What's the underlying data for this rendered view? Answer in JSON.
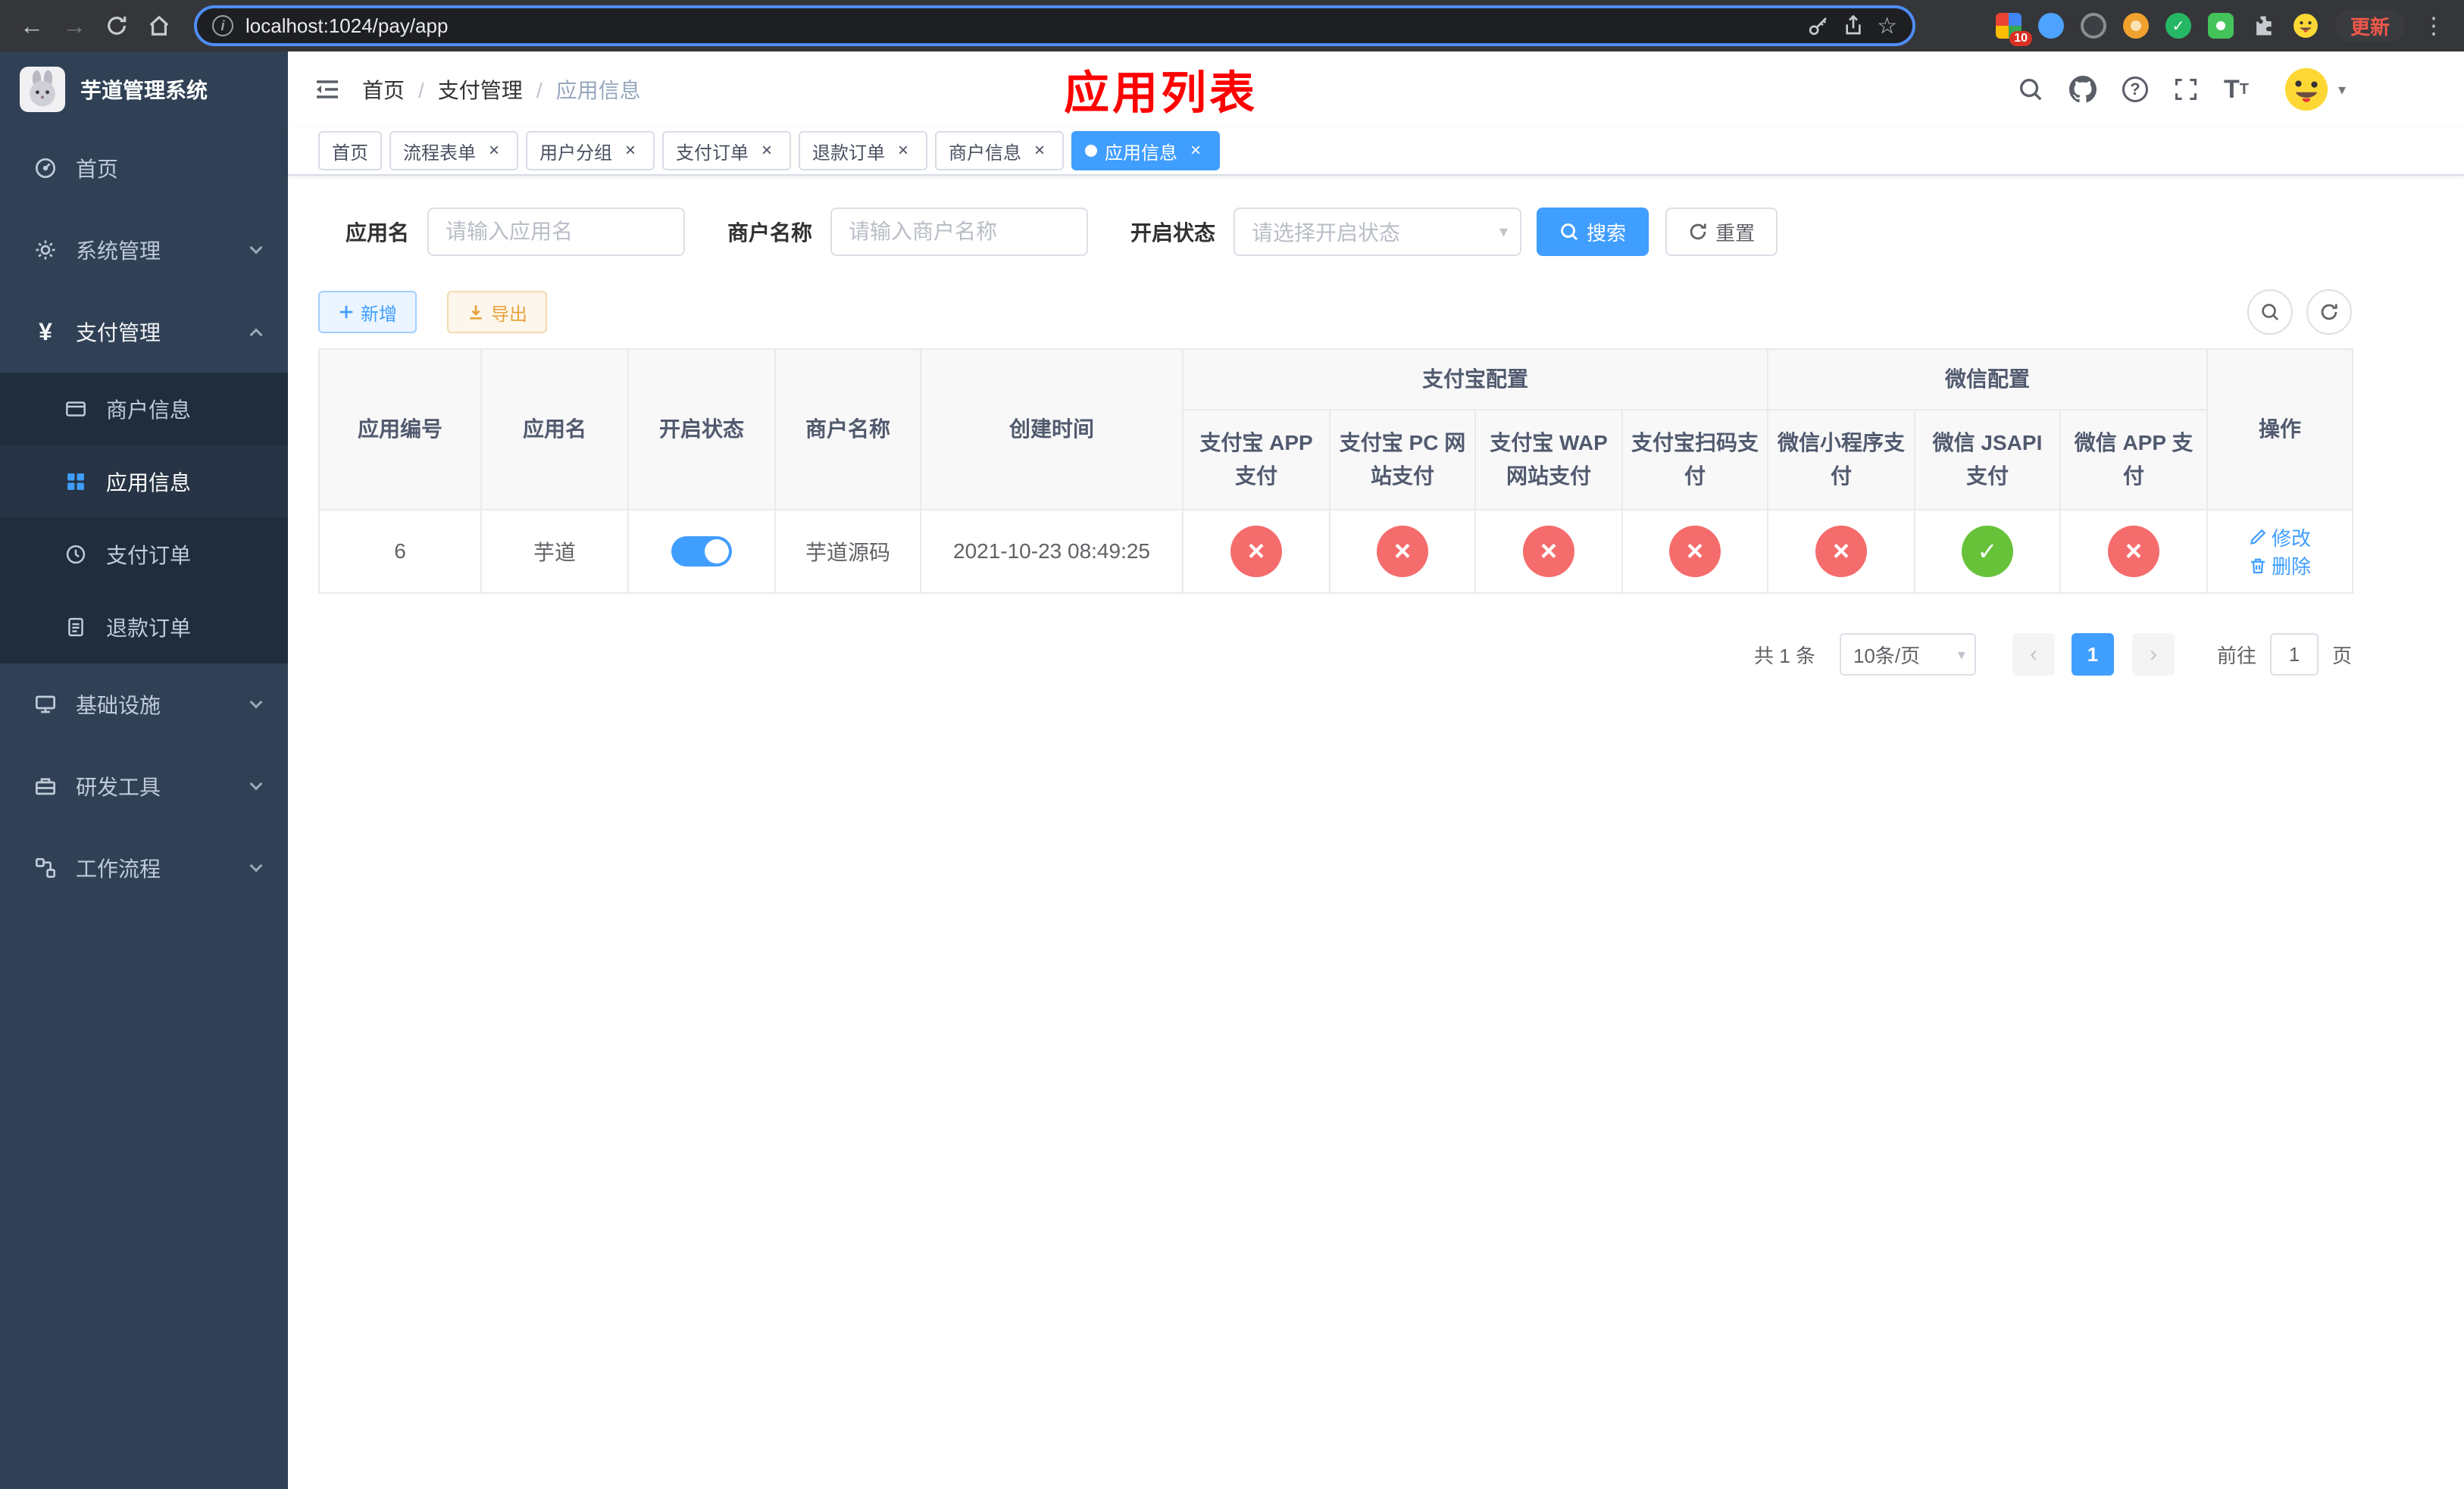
{
  "colors": {
    "accent": "#409eff",
    "danger": "#f56c6c",
    "success": "#67c23a",
    "warning": "#e6a23c",
    "title_red": "#ff0000"
  },
  "browser": {
    "url": "localhost:1024/pay/app",
    "extension_badge": "10",
    "update_label": "更新"
  },
  "sidebar": {
    "title": "芋道管理系统",
    "items": [
      {
        "label": "首页"
      },
      {
        "label": "系统管理"
      },
      {
        "label": "支付管理",
        "children": [
          {
            "label": "商户信息"
          },
          {
            "label": "应用信息"
          },
          {
            "label": "支付订单"
          },
          {
            "label": "退款订单"
          }
        ]
      },
      {
        "label": "基础设施"
      },
      {
        "label": "研发工具"
      },
      {
        "label": "工作流程"
      }
    ]
  },
  "header": {
    "breadcrumb": [
      "首页",
      "支付管理",
      "应用信息"
    ],
    "page_title": "应用列表"
  },
  "tabs": [
    {
      "label": "首页"
    },
    {
      "label": "流程表单"
    },
    {
      "label": "用户分组"
    },
    {
      "label": "支付订单"
    },
    {
      "label": "退款订单"
    },
    {
      "label": "商户信息"
    },
    {
      "label": "应用信息"
    }
  ],
  "filters": {
    "app_name_label": "应用名",
    "app_name_placeholder": "请输入应用名",
    "merchant_label": "商户名称",
    "merchant_placeholder": "请输入商户名称",
    "status_label": "开启状态",
    "status_placeholder": "请选择开启状态",
    "search_label": "搜索",
    "reset_label": "重置"
  },
  "toolbar": {
    "add_label": "新增",
    "export_label": "导出"
  },
  "table": {
    "columns": [
      "应用编号",
      "应用名",
      "开启状态",
      "商户名称",
      "创建时间"
    ],
    "groups": [
      {
        "label": "支付宝配置",
        "children": [
          "支付宝 APP 支付",
          "支付宝 PC 网站支付",
          "支付宝 WAP 网站支付",
          "支付宝扫码支付"
        ]
      },
      {
        "label": "微信配置",
        "children": [
          "微信小程序支付",
          "微信 JSAPI 支付",
          "微信 APP 支付"
        ]
      }
    ],
    "action_column": "操作",
    "rows": [
      {
        "id": "6",
        "name": "芋道",
        "enabled": true,
        "merchant": "芋道源码",
        "created": "2021-10-23 08:49:25",
        "channels": [
          "no",
          "no",
          "no",
          "no",
          "no",
          "yes",
          "no"
        ],
        "actions": {
          "edit": "修改",
          "delete": "删除"
        }
      }
    ]
  },
  "pagination": {
    "total_text": "共 1 条",
    "page_size": "10条/页",
    "current_page": "1",
    "goto_label": "前往",
    "goto_value": "1",
    "page_unit": "页"
  }
}
